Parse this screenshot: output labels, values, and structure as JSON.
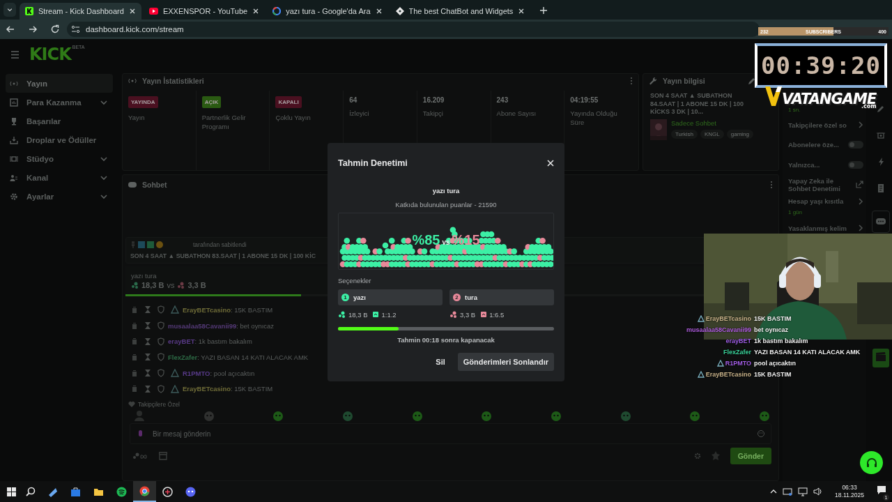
{
  "browser": {
    "tabs": [
      {
        "title": "Stream - Kick Dashboard",
        "selected": true
      },
      {
        "title": "EXXENSPOR - YouTube",
        "selected": false
      },
      {
        "title": "yazı tura - Google'da Ara",
        "selected": false
      },
      {
        "title": "The best ChatBot and Widgets",
        "selected": false
      }
    ],
    "url": "dashboard.kick.com/stream"
  },
  "header": {
    "logo": "KICK",
    "logo_tag": "BETA"
  },
  "sidebar": {
    "items": [
      {
        "label": "Yayın",
        "selected": true,
        "submenu": false
      },
      {
        "label": "Para Kazanma",
        "selected": false,
        "submenu": true
      },
      {
        "label": "Başarılar",
        "selected": false,
        "submenu": false
      },
      {
        "label": "Droplar ve Ödüller",
        "selected": false,
        "submenu": false
      },
      {
        "label": "Stüdyo",
        "selected": false,
        "submenu": true
      },
      {
        "label": "Kanal",
        "selected": false,
        "submenu": true
      },
      {
        "label": "Ayarlar",
        "selected": false,
        "submenu": true
      }
    ]
  },
  "stream_stats": {
    "title": "Yayın İstatistikleri",
    "cards": [
      {
        "kind": "badge",
        "badge": "YAYINDA",
        "color": "#4a1020",
        "label": "Yayın"
      },
      {
        "kind": "badge",
        "badge": "AÇIK",
        "color": "#2a5a12",
        "label": "Partnerlik Gelir Programı"
      },
      {
        "kind": "badge",
        "badge": "KAPALI",
        "color": "#4a1020",
        "label": "Çoklu Yayın"
      },
      {
        "kind": "number",
        "value": "64",
        "label": "İzleyici"
      },
      {
        "kind": "number",
        "value": "16.209",
        "label": "Takipçi"
      },
      {
        "kind": "number",
        "value": "243",
        "label": "Abone Sayısı"
      },
      {
        "kind": "number",
        "value": "04:19:55",
        "label": "Yayında Olduğu Süre"
      }
    ]
  },
  "stream_info": {
    "title": "Yayın bilgisi",
    "stream_title": "SON 4 SAAT ▲ SUBATHON 84.SAAT | 1 ABONE 15 DK | 100 KİCKS 3 DK | 10...",
    "category": "Sadece Sohbet",
    "tags": [
      "Turkish",
      "KNGL",
      "gaming"
    ]
  },
  "chat_settings": {
    "items": [
      {
        "kind": "value",
        "value": "1 sn."
      },
      {
        "kind": "link",
        "label": "Takipçilere özel so"
      },
      {
        "kind": "toggle",
        "label": "Abonelere öze...",
        "on": false
      },
      {
        "kind": "toggle",
        "label": "Yalnızca...",
        "on": false
      },
      {
        "kind": "external",
        "label": "Yapay Zeka ile Sohbet Denetimi"
      },
      {
        "kind": "link",
        "label": "Hesap yaşı kısıtla",
        "value": "1 gün"
      },
      {
        "kind": "link",
        "label": "Yasaklanmış kelim"
      }
    ]
  },
  "chat": {
    "title": "Sohbet",
    "pinned": {
      "by": "tarafından sabitlendi",
      "message": "SON 4 SAAT ▲ SUBATHON 83.SAAT | 1 ABONE 15 DK | 100 KİC"
    },
    "prediction": {
      "title": "yazı tura",
      "left": "18,3 B",
      "vs": "vs",
      "right": "3,3 B",
      "level": 0.27
    },
    "messages": [
      {
        "user": "ErayBETcasino",
        "badge": true,
        "color": "#6f6c38",
        "text": "15K BASTIM"
      },
      {
        "user": "musaalaa58Cavanii99",
        "badge": false,
        "color": "#553a78",
        "text": "bet oynıcaz"
      },
      {
        "user": "erayBET",
        "badge": false,
        "color": "#5a3a88",
        "text": "1k bastım bakalım"
      },
      {
        "user": "FlexZafer",
        "badge": false,
        "color": "#2d6a45",
        "text": "YAZI BASAN 14 KATI ALACAK AMK"
      },
      {
        "user": "R1PMTO",
        "badge": true,
        "color": "#573a88",
        "text": "pool açıcaktın"
      },
      {
        "user": "ErayBETcasino",
        "badge": true,
        "color": "#6f6c38",
        "text": "15K BASTIM"
      }
    ],
    "separator": ":",
    "section_label": "Takipçilere Özel",
    "placeholder": "Bir mesaj gönderin",
    "send": "Gönder"
  },
  "modal": {
    "title": "Tahmin Denetimi",
    "question": "yazı tura",
    "points": "Katkıda bulunulan puanlar - 21590",
    "percent_left": "%85",
    "vs": "vs",
    "percent_right": "%15",
    "options_label": "Seçenekler",
    "options": [
      {
        "number": "1",
        "label": "yazı",
        "color": "#3cf0a5",
        "points": "18,3 B",
        "ratio": "1:1.2"
      },
      {
        "number": "2",
        "label": "tura",
        "color": "#e8899a",
        "points": "3,3 B",
        "ratio": "1:6.5"
      }
    ],
    "level": 0.28,
    "timer": "Tahmin 00:18 sonra kapanacak",
    "delete": "Sil",
    "end": "Gönderimleri Sonlandır"
  },
  "overlay": {
    "subs": {
      "current": "232",
      "label": "SUBSCRIBERS",
      "goal": "400",
      "level": 0.58
    },
    "timer": "00:39:20",
    "logo": "VATANGAME",
    "logo_suffix": ".com",
    "chat": [
      {
        "user": "ErayBETcasino",
        "badge": true,
        "color": "#c9b38a",
        "text": "15K BASTIM"
      },
      {
        "user": "musaalaa58Cavanii99",
        "badge": false,
        "color": "#b05ee0",
        "text": "bet oynıcaz"
      },
      {
        "user": "erayBET",
        "badge": false,
        "color": "#a05ee8",
        "text": "1k bastım bakalım"
      },
      {
        "user": "FlexZafer",
        "badge": false,
        "color": "#39d39a",
        "text": "YAZI BASAN 14 KATI ALACAK AMK"
      },
      {
        "user": "R1PMTO",
        "badge": true,
        "color": "#a55ee8",
        "text": "pool açıcaktın"
      },
      {
        "user": "ErayBETcasino",
        "badge": true,
        "color": "#c9b38a",
        "text": "15K BASTIM"
      }
    ]
  },
  "taskbar": {
    "apps": [
      {
        "selected": false
      },
      {
        "selected": false
      },
      {
        "selected": false
      },
      {
        "selected": false
      },
      {
        "selected": true
      },
      {
        "selected": false
      },
      {
        "selected": false
      }
    ],
    "time": "06:33",
    "date": "18.11.2025",
    "notifications": "1"
  }
}
